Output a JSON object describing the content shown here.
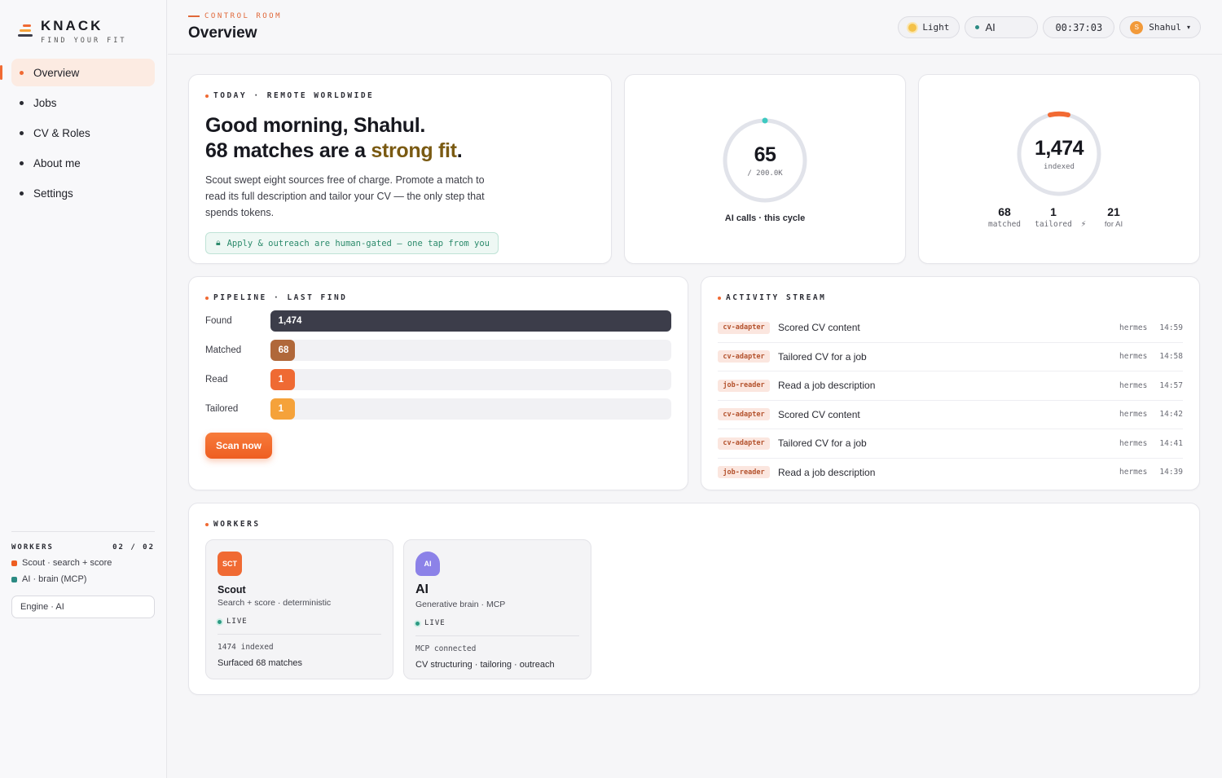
{
  "brand": {
    "name": "KNACK",
    "tagline": "FIND YOUR FIT"
  },
  "nav": [
    {
      "label": "Overview",
      "active": true
    },
    {
      "label": "Jobs"
    },
    {
      "label": "CV & Roles"
    },
    {
      "label": "About me"
    },
    {
      "label": "Settings"
    }
  ],
  "sidebar_workers": {
    "title": "WORKERS",
    "count": "02 / 02",
    "items": [
      {
        "label": "Scout · search + score",
        "color": "#ee5e22"
      },
      {
        "label": "AI · brain (MCP)",
        "color": "#2c8a83"
      }
    ],
    "engine": "Engine · AI"
  },
  "header": {
    "eyebrow": "CONTROL ROOM",
    "title": "Overview",
    "theme": "Light",
    "ai_label": "AI",
    "timer": "00:37:03",
    "user": "Shahul",
    "user_initial": "S"
  },
  "hero": {
    "eyebrow": "TODAY · REMOTE WORLDWIDE",
    "line1": "Good morning, Shahul.",
    "line2_prefix": "68 matches are a ",
    "line2_emph": "strong fit",
    "line2_suffix": ".",
    "blurb": "Scout swept eight sources free of charge. Promote a match to read its full description and tailor your CV — the only step that spends tokens.",
    "gate": "Apply & outreach are human-gated — one tap from you"
  },
  "ai_calls": {
    "value": "65",
    "limit": "/ 200.0K",
    "caption": "AI calls · this cycle",
    "fraction": 0.0003
  },
  "indexed": {
    "value": "1,474",
    "label": "indexed",
    "stats": [
      {
        "value": "68",
        "label": "matched"
      },
      {
        "value": "1",
        "label": "tailored"
      },
      {
        "value": "21",
        "label": "for AI"
      }
    ],
    "bolt": "⚡"
  },
  "pipeline": {
    "title": "PIPELINE · LAST FIND",
    "rows": [
      {
        "label": "Found",
        "value": "1,474",
        "fraction": 1.0,
        "color": "#3c3d4a"
      },
      {
        "label": "Matched",
        "value": "68",
        "fraction": 0.06,
        "color": "#b0683a"
      },
      {
        "label": "Read",
        "value": "1",
        "fraction": 0.06,
        "color": "#ef6a33"
      },
      {
        "label": "Tailored",
        "value": "1",
        "fraction": 0.06,
        "color": "#f5a23a"
      }
    ],
    "button": "Scan now"
  },
  "activity": {
    "title": "ACTIVITY STREAM",
    "rows": [
      {
        "tag": "cv-adapter",
        "text": "Scored CV content",
        "who": "hermes",
        "time": "14:59"
      },
      {
        "tag": "cv-adapter",
        "text": "Tailored CV for a job",
        "who": "hermes",
        "time": "14:58"
      },
      {
        "tag": "job-reader",
        "text": "Read a job description",
        "who": "hermes",
        "time": "14:57"
      },
      {
        "tag": "cv-adapter",
        "text": "Scored CV content",
        "who": "hermes",
        "time": "14:42"
      },
      {
        "tag": "cv-adapter",
        "text": "Tailored CV for a job",
        "who": "hermes",
        "time": "14:41"
      },
      {
        "tag": "job-reader",
        "text": "Read a job description",
        "who": "hermes",
        "time": "14:39"
      }
    ]
  },
  "workers": {
    "title": "WORKERS",
    "cards": [
      {
        "icon": "SCT",
        "name": "Scout",
        "desc": "Search + score · deterministic",
        "status": "LIVE",
        "stat": "1474 indexed",
        "foot": "Surfaced 68 matches",
        "color": "#f06a33"
      },
      {
        "icon": "AI",
        "name": "AI",
        "desc": "Generative brain · MCP",
        "status": "LIVE",
        "stat": "MCP connected",
        "foot": "CV structuring · tailoring · outreach",
        "color": "#8c82e8"
      }
    ]
  }
}
